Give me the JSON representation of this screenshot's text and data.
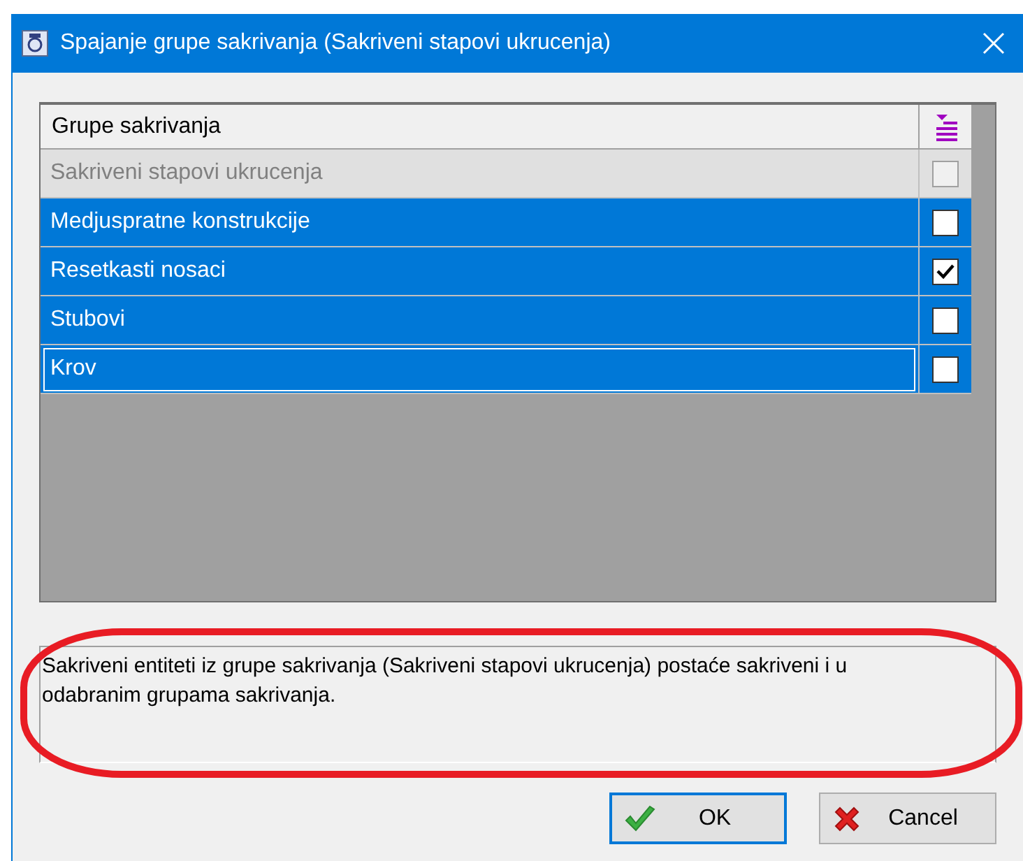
{
  "window": {
    "title": "Spajanje grupe sakrivanja (Sakriveni stapovi ukrucenja)"
  },
  "table": {
    "columns": [
      "Grupe sakrivanja"
    ],
    "rows": [
      {
        "label": "Sakriveni stapovi ukrucenja",
        "disabled": true,
        "selected": false,
        "focused": false,
        "checked": false
      },
      {
        "label": "Medjuspratne konstrukcije",
        "disabled": false,
        "selected": true,
        "focused": false,
        "checked": false
      },
      {
        "label": "Resetkasti nosaci",
        "disabled": false,
        "selected": true,
        "focused": false,
        "checked": true
      },
      {
        "label": "Stubovi",
        "disabled": false,
        "selected": true,
        "focused": false,
        "checked": false
      },
      {
        "label": "Krov",
        "disabled": false,
        "selected": true,
        "focused": true,
        "checked": false
      }
    ]
  },
  "description": "Sakriveni entiteti iz grupe sakrivanja (Sakriveni stapovi ukrucenja) postaće sakriveni i u odabranim grupama sakrivanja.",
  "annotation": {
    "kind": "ellipse"
  },
  "buttons": [
    {
      "label": "OK",
      "kind": "ok",
      "default": true
    },
    {
      "label": "Cancel",
      "kind": "cancel",
      "default": false
    }
  ]
}
